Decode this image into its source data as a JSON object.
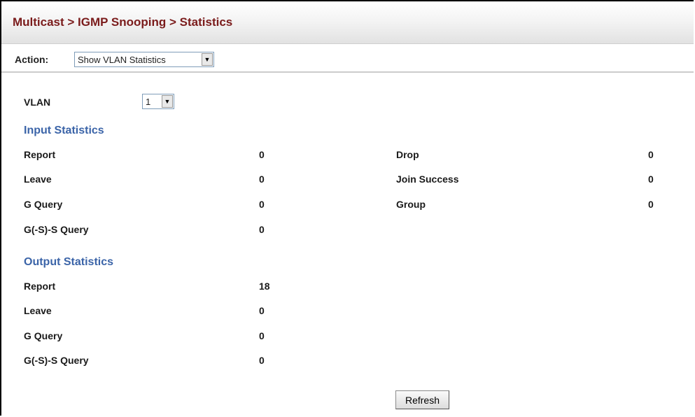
{
  "breadcrumb": "Multicast > IGMP Snooping > Statistics",
  "action": {
    "label": "Action:",
    "selected": "Show VLAN Statistics"
  },
  "vlan": {
    "label": "VLAN",
    "selected": "1"
  },
  "input_statistics": {
    "title": "Input Statistics",
    "left": [
      {
        "label": "Report",
        "value": "0"
      },
      {
        "label": "Leave",
        "value": "0"
      },
      {
        "label": "G Query",
        "value": "0"
      },
      {
        "label": "G(-S)-S Query",
        "value": "0"
      }
    ],
    "right": [
      {
        "label": "Drop",
        "value": "0"
      },
      {
        "label": "Join Success",
        "value": "0"
      },
      {
        "label": "Group",
        "value": "0"
      }
    ]
  },
  "output_statistics": {
    "title": "Output Statistics",
    "rows": [
      {
        "label": "Report",
        "value": "18"
      },
      {
        "label": "Leave",
        "value": "0"
      },
      {
        "label": "G Query",
        "value": "0"
      },
      {
        "label": "G(-S)-S Query",
        "value": "0"
      }
    ]
  },
  "refresh_label": "Refresh"
}
